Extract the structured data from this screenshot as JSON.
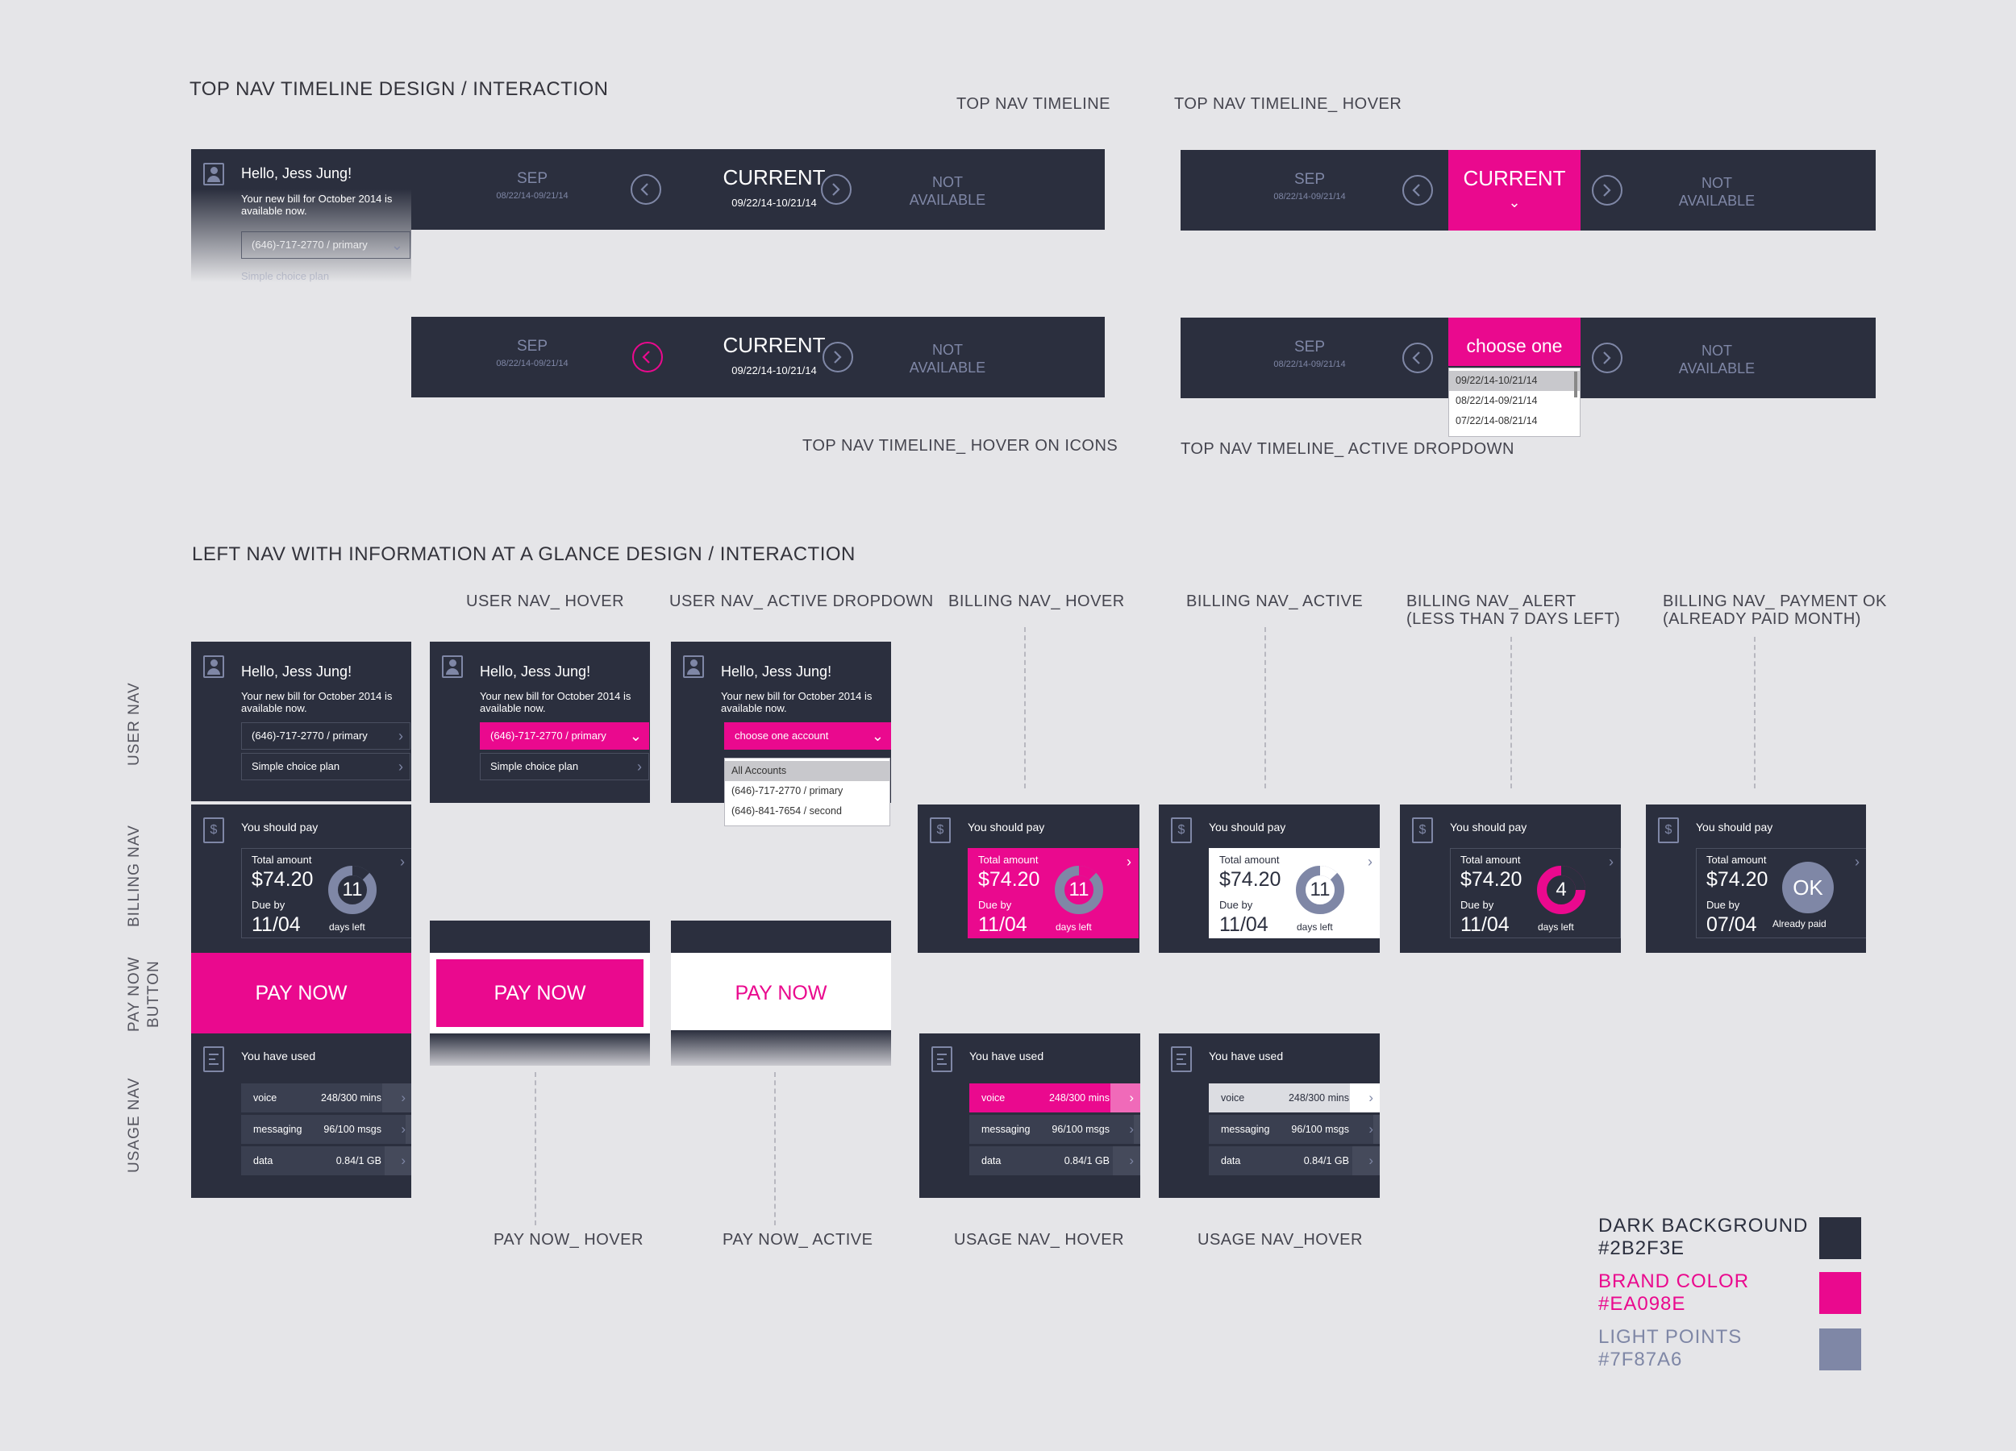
{
  "colors": {
    "dark": "#2B2F3E",
    "brand": "#EA098E",
    "light": "#7F87A6"
  },
  "top_section": {
    "title": "TOP NAV TIMELINE DESIGN / INTERACTION",
    "label_timeline": "TOP NAV TIMELINE",
    "label_hover": "TOP NAV TIMELINE_ HOVER",
    "label_hover_icons": "TOP NAV TIMELINE_ HOVER ON ICONS",
    "label_active_dropdown": "TOP NAV TIMELINE_ ACTIVE DROPDOWN",
    "prev_label": "SEP",
    "prev_range": "08/22/14-09/21/14",
    "current_label": "CURRENT",
    "current_range": "09/22/14-10/21/14",
    "next_label_1": "NOT",
    "next_label_2": "AVAILABLE",
    "choose_label": "choose one",
    "dropdown_options": [
      "09/22/14-10/21/14",
      "08/22/14-09/21/14",
      "07/22/14-08/21/14"
    ]
  },
  "user": {
    "greeting": "Hello, Jess Jung!",
    "message": "Your new bill for October 2014 is available now.",
    "account": "(646)-717-2770 / primary",
    "plan": "Simple choice plan",
    "choose_account": "choose one account",
    "account_options": [
      "All Accounts",
      "(646)-717-2770 / primary",
      "(646)-841-7654 / second"
    ]
  },
  "left_section": {
    "title": "LEFT NAV WITH INFORMATION AT A GLANCE DESIGN / INTERACTION",
    "user_nav_hover": "USER NAV_ HOVER",
    "user_nav_active": "USER NAV_ ACTIVE DROPDOWN",
    "billing_hover": "BILLING NAV_ HOVER",
    "billing_active": "BILLING NAV_ ACTIVE",
    "billing_alert_1": "BILLING NAV_ ALERT",
    "billing_alert_2": "(LESS THAN 7 DAYS LEFT)",
    "billing_ok_1": "BILLING NAV_ PAYMENT OK",
    "billing_ok_2": "(ALREADY PAID MONTH)",
    "pay_now_hover": "PAY NOW_ HOVER",
    "pay_now_active": "PAY NOW_ ACTIVE",
    "usage_hover_1": "USAGE NAV_ HOVER",
    "usage_hover_2": "USAGE NAV_HOVER",
    "side_user": "USER NAV",
    "side_billing": "BILLING NAV",
    "side_pay_1": "PAY NOW",
    "side_pay_2": "BUTTON",
    "side_usage": "USAGE NAV"
  },
  "billing": {
    "title": "You should pay",
    "total_label": "Total amount",
    "amount": "$74.20",
    "due_label": "Due by",
    "due_date": "11/04",
    "days": "11",
    "days_label": "days left",
    "alert_days": "4",
    "ok_due_date": "07/04",
    "ok_label": "OK",
    "already_paid": "Already paid"
  },
  "pay_now": "PAY NOW",
  "usage": {
    "title": "You have used",
    "rows": [
      {
        "name": "voice",
        "value": "248/300 mins",
        "ratio": 0.8267
      },
      {
        "name": "messaging",
        "value": "96/100 msgs",
        "ratio": 0.96
      },
      {
        "name": "data",
        "value": "0.84/1 GB",
        "ratio": 0.84
      }
    ]
  },
  "legend": {
    "dark_label": "DARK BACKGROUND",
    "dark_hex": "#2B2F3E",
    "brand_label": "BRAND COLOR",
    "brand_hex": "#EA098E",
    "light_label": "LIGHT POINTS",
    "light_hex": "#7F87A6"
  }
}
